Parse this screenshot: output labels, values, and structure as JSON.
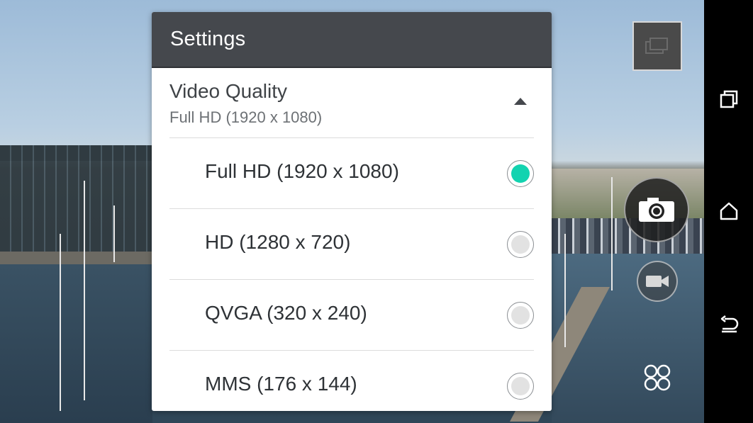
{
  "settings_dialog": {
    "title": "Settings",
    "video_quality": {
      "label": "Video Quality",
      "current_value": "Full HD (1920 x 1080)",
      "expanded": true,
      "options": [
        {
          "label": "Full HD (1920 x 1080)",
          "selected": true
        },
        {
          "label": "HD (1280 x 720)",
          "selected": false
        },
        {
          "label": "QVGA (320 x 240)",
          "selected": false
        },
        {
          "label": "MMS (176 x 144)",
          "selected": false
        }
      ]
    },
    "colors": {
      "header_bg": "#45484d",
      "selected_radio": "#12d3b0"
    }
  },
  "camera_controls": {
    "icons": [
      "gallery-thumbnail-icon",
      "camera-shutter-icon",
      "video-camera-icon",
      "camera-modes-icon"
    ]
  },
  "navigation_bar": {
    "icons": [
      "recent-apps-icon",
      "home-icon",
      "back-icon"
    ]
  }
}
